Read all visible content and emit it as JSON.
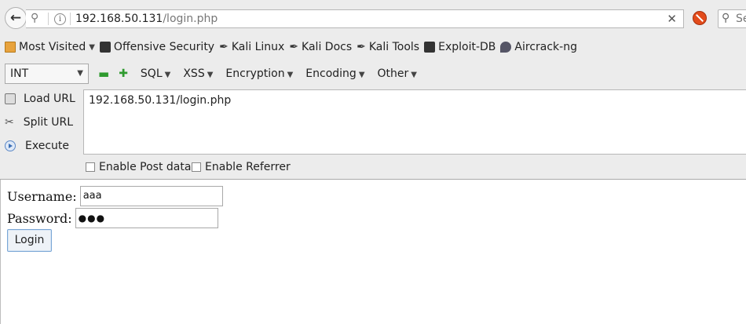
{
  "navbar": {
    "url_host": "192.168.50.131",
    "url_path": "/login.php",
    "search_placeholder": "Se"
  },
  "bookmarks": [
    {
      "label": "Most Visited",
      "icon": "folder-icon",
      "dropdown": true
    },
    {
      "label": "Offensive Security",
      "icon": "offsec-icon",
      "dropdown": false
    },
    {
      "label": "Kali Linux",
      "icon": "kali-dragon-icon",
      "dropdown": false
    },
    {
      "label": "Kali Docs",
      "icon": "kali-dragon-icon",
      "dropdown": false
    },
    {
      "label": "Kali Tools",
      "icon": "kali-dragon-icon",
      "dropdown": false
    },
    {
      "label": "Exploit-DB",
      "icon": "exploitdb-icon",
      "dropdown": false
    },
    {
      "label": "Aircrack-ng",
      "icon": "satellite-icon",
      "dropdown": false
    }
  ],
  "hackbar": {
    "select_value": "INT",
    "menus": [
      "SQL",
      "XSS",
      "Encryption",
      "Encoding",
      "Other"
    ],
    "actions": {
      "load": "Load URL",
      "split": "Split URL",
      "execute": "Execute"
    },
    "url_value": "192.168.50.131/login.php",
    "options": {
      "post": "Enable Post data",
      "referrer": "Enable Referrer"
    }
  },
  "form": {
    "username_label": "Username:",
    "username_value": "aaa",
    "password_label": "Password:",
    "password_value": "●●●",
    "login_label": "Login"
  }
}
